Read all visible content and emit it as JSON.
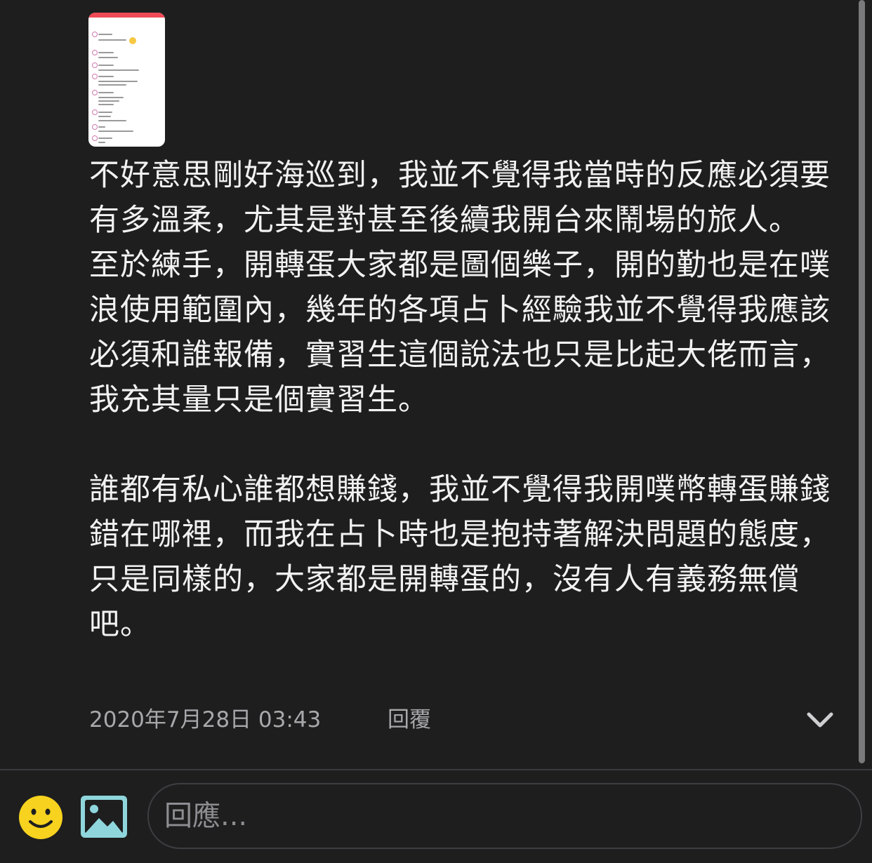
{
  "comment": {
    "paragraphs": [
      "不好意思剛好海巡到，我並不覺得我當時的反應必須要有多溫柔，尤其是對甚至後續我開台來鬧場的旅人。",
      "至於練手，開轉蛋大家都是圖個樂子，開的勤也是在噗浪使用範圍內，幾年的各項占卜經驗我並不覺得我應該必須和誰報備，實習生這個說法也只是比起大佬而言，我充其量只是個實習生。",
      "誰都有私心誰都想賺錢，我並不覺得我開噗幣轉蛋賺錢錯在哪裡，而我在占卜時也是抱持著解決問題的態度，只是同樣的，大家都是開轉蛋的，沒有人有義務無償吧。"
    ],
    "timestamp": "2020年7月28日 03:43",
    "reply_label": "回覆"
  },
  "composer": {
    "placeholder": "回應..."
  },
  "icons": {
    "expand": "chevron-down-icon",
    "emoji": "smiley-icon",
    "image": "image-icon"
  },
  "colors": {
    "background": "#1e1e1f",
    "text": "#f2f2f2",
    "muted": "#a8a8ab",
    "emoji_yellow": "#f7d21e",
    "image_icon": "#8fd6dc"
  }
}
